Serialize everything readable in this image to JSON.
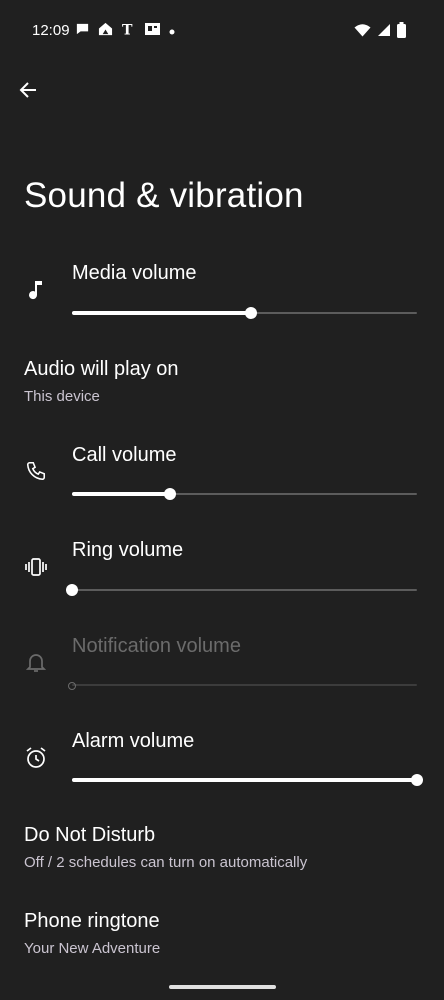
{
  "status_bar": {
    "time": "12:09",
    "left_icons": [
      "chat-bubble-icon",
      "home-app-icon",
      "news-t-icon",
      "news-paper-icon",
      "dot-icon"
    ],
    "right_icons": [
      "wifi-icon",
      "cell-signal-icon",
      "battery-icon"
    ]
  },
  "header": {
    "title": "Sound & vibration"
  },
  "sections": {
    "media": {
      "label": "Media volume",
      "level": 0.52
    },
    "audio_output": {
      "title": "Audio will play on",
      "subtitle": "This device"
    },
    "call": {
      "label": "Call volume",
      "level": 0.285
    },
    "ring": {
      "label": "Ring volume",
      "level": 0.0
    },
    "notification": {
      "label": "Notification volume",
      "level": 0.0,
      "disabled": true
    },
    "alarm": {
      "label": "Alarm volume",
      "level": 1.0
    },
    "dnd": {
      "title": "Do Not Disturb",
      "subtitle": "Off / 2 schedules can turn on automatically"
    },
    "ringtone": {
      "title": "Phone ringtone",
      "subtitle": "Your New Adventure"
    }
  },
  "colors": {
    "background": "#202020",
    "text_primary": "#ffffff",
    "text_secondary": "#cac4d0",
    "disabled": "#6b6b6b",
    "slider_fill": "#ffffff",
    "slider_track": "#5c5c5c"
  }
}
